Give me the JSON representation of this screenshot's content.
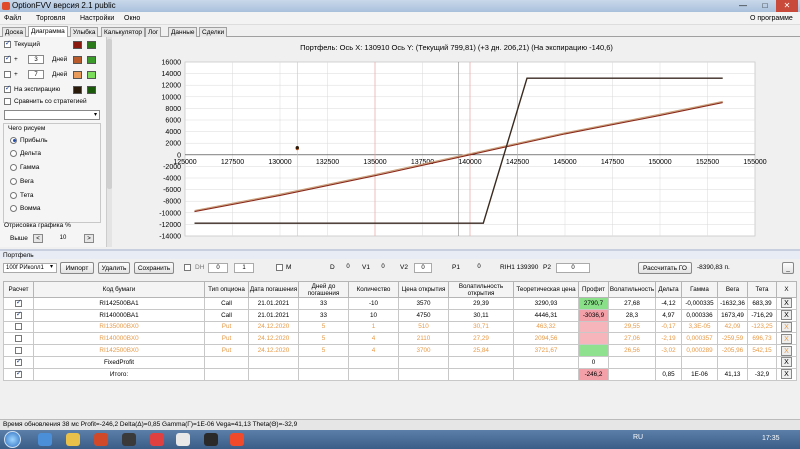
{
  "window": {
    "title": "OptionFVV версия 2.1 public",
    "minimize": "—",
    "maximize": "□",
    "close": "✕"
  },
  "menu": {
    "items": [
      "Файл",
      "Торговля",
      "Настройки",
      "Окно"
    ],
    "about": "О программе"
  },
  "tabs": [
    "Доска",
    "Диаграмма",
    "Улыбка",
    "Калькулятор",
    "Лог",
    "Данные",
    "Сделки"
  ],
  "left": {
    "current_label": "Текущий",
    "plus1": "+",
    "days1": "3",
    "days_label": "Дней",
    "plus2": "+",
    "days2": "7",
    "expiry_label": "На экспирацию",
    "compare_label": "Сравнить со стратегией",
    "what_label": "Чего рисуем",
    "options": [
      "Прибыль",
      "Дельта",
      "Гамма",
      "Вега",
      "Тета",
      "Вомма"
    ],
    "render_label": "Отрисовка графика %",
    "above_label": "Выше",
    "above_value": "10",
    "spin_left": "<",
    "spin_right": ">",
    "colors": {
      "current1": "#8a1a10",
      "current2": "#2a7a1a",
      "d3a": "#b85a2a",
      "d3b": "#3a9a2a",
      "d7a": "#e89a5a",
      "d7b": "#7adc5a",
      "exp1": "#2a1a0a",
      "exp2": "#1a5a0a"
    }
  },
  "chart": {
    "title": "Портфель: Ось X: 130910 Ось Y:  (Текущий 799,81)  (+3 дн. 206,21)  (На экспирацию -140,6)"
  },
  "chart_data": {
    "type": "line",
    "xlim": [
      125000,
      155000
    ],
    "ylim": [
      -14000,
      16000
    ],
    "xticks": [
      "125000",
      "127500",
      "130000",
      "132500",
      "135000",
      "137500",
      "140000",
      "142500",
      "145000",
      "147500",
      "150000",
      "152500",
      "155000"
    ],
    "yticks": [
      "16000",
      "14000",
      "12000",
      "10000",
      "8000",
      "6000",
      "4000",
      "2000",
      "0",
      "-2000",
      "-4000",
      "-6000",
      "-8000",
      "-10000",
      "-12000",
      "-14000"
    ],
    "series": [
      {
        "color": "#c9a07a",
        "x": [
          125500,
          130000,
          135000,
          140000,
          145000,
          150000,
          153300
        ],
        "y": [
          -9600,
          -6800,
          -3400,
          200,
          3800,
          7000,
          9200
        ]
      },
      {
        "color": "#8a2a1a",
        "x": [
          125500,
          130000,
          135000,
          140000,
          145000,
          150000,
          153300
        ],
        "y": [
          -9800,
          -7000,
          -3600,
          0,
          3600,
          6800,
          9000
        ]
      },
      {
        "color": "#3a2a20",
        "x": [
          125500,
          140700,
          143000,
          153300
        ],
        "y": [
          -11800,
          -11800,
          13200,
          13200
        ]
      }
    ],
    "markers": {
      "x": 130910,
      "y_values": [
        800,
        200,
        -141
      ]
    }
  },
  "portfolio": {
    "label": "Портфель",
    "account": "100f РИколл1",
    "import_btn": "Импорт",
    "delete_btn": "Удалить",
    "save_btn": "Сохранить",
    "dh_label": "DH",
    "dh_val1": "0",
    "dh_val2": "1",
    "m_label": "M",
    "d_label": "D",
    "d_val": "0",
    "v1_label": "V1",
    "v1_val": "0",
    "v2_label": "V2",
    "v2_val": "0",
    "p1_label": "P1",
    "p1_val": "0",
    "ticker_info": "RIH1 139390",
    "p2_label": "P2",
    "p2_val": "0",
    "calc_btn": "Рассчитать ГО",
    "go_value": "-8390,83 п.",
    "minimize_btn": "_"
  },
  "table": {
    "headers": [
      "Расчет",
      "Код бумаги",
      "Тип опциона",
      "Дата погашения",
      "Дней до погашения",
      "Количество",
      "Цена открытия",
      "Волатильность открытия",
      "Теоретическая цена",
      "Профит",
      "Волатильность",
      "Дельта",
      "Гамма",
      "Вега",
      "Тета",
      "X"
    ],
    "rows": [
      {
        "checked": true,
        "dim": false,
        "profit_class": "pos",
        "cells": [
          "RI142500BA1",
          "Call",
          "21.01.2021",
          "33",
          "-10",
          "3570",
          "29,39",
          "3290,93",
          "2790,7",
          "27,68",
          "-4,12",
          "-0,000335",
          "-1632,36",
          "683,39"
        ]
      },
      {
        "checked": true,
        "dim": false,
        "profit_class": "neg",
        "cells": [
          "RI140000BA1",
          "Call",
          "21.01.2021",
          "33",
          "10",
          "4750",
          "30,11",
          "4446,31",
          "-3036,9",
          "28,3",
          "4,97",
          "0,000336",
          "1673,49",
          "-716,29"
        ]
      },
      {
        "checked": false,
        "dim": true,
        "profit_class": "neg",
        "cells": [
          "RI135000BX0",
          "Put",
          "24.12.2020",
          "5",
          "1",
          "510",
          "30,71",
          "463,32",
          "",
          "29,55",
          "-0,17",
          "3,3E-05",
          "42,09",
          "-123,25"
        ]
      },
      {
        "checked": false,
        "dim": true,
        "profit_class": "neg",
        "cells": [
          "RI140000BX0",
          "Put",
          "24.12.2020",
          "5",
          "4",
          "2110",
          "27,29",
          "2094,56",
          "",
          "27,06",
          "-2,19",
          "0,000357",
          "-259,59",
          "696,73"
        ]
      },
      {
        "checked": false,
        "dim": true,
        "profit_class": "pos",
        "cells": [
          "RI142500BX0",
          "Put",
          "24.12.2020",
          "5",
          "4",
          "3700",
          "25,84",
          "3721,67",
          "",
          "26,56",
          "-3,02",
          "0,000289",
          "-205,96",
          "542,15"
        ]
      },
      {
        "checked": true,
        "dim": false,
        "profit_class": "",
        "cells": [
          "FixedProfit",
          "",
          "",
          "",
          "",
          "",
          "",
          "",
          "0",
          "",
          "",
          "",
          "",
          ""
        ]
      },
      {
        "checked": true,
        "dim": false,
        "profit_class": "neg",
        "cells": [
          "Итого:",
          "",
          "",
          "",
          "",
          "",
          "",
          "",
          "-246,2",
          "",
          "0,85",
          "1E-06",
          "41,13",
          "-32,9"
        ]
      }
    ],
    "x_label": "X"
  },
  "status": {
    "text": "Время обновления 38 мс  Profit=-246,2 Delta(Δ)=0,85 Gamma(Γ)=1E-06 Vega=41,13 Theta(Θ)=-32,9"
  },
  "taskbar": {
    "lang": "RU",
    "time": "17:35"
  }
}
